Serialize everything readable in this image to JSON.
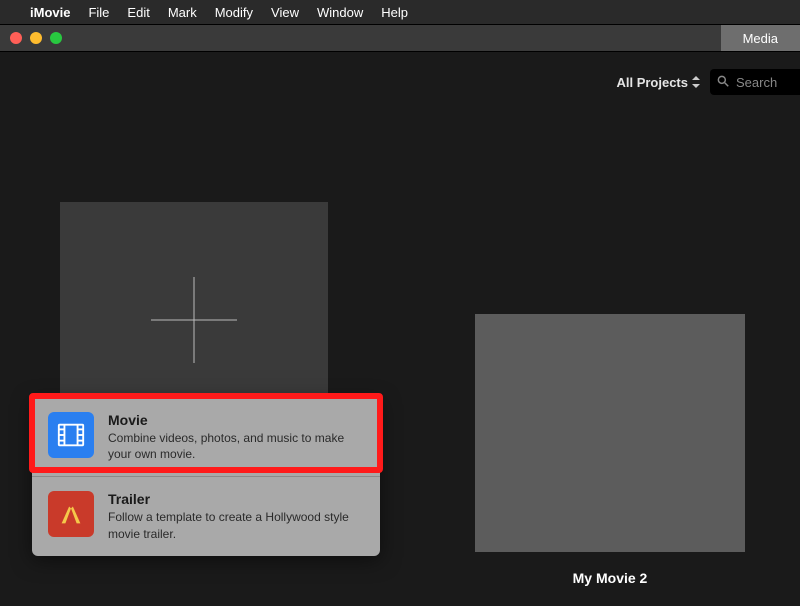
{
  "menubar": {
    "apple": "",
    "app": "iMovie",
    "items": [
      "File",
      "Edit",
      "Mark",
      "Modify",
      "View",
      "Window",
      "Help"
    ]
  },
  "window": {
    "tab": "Media"
  },
  "toolbar": {
    "dropdown_label": "All Projects",
    "search_placeholder": "Search"
  },
  "popover": {
    "items": [
      {
        "title": "Movie",
        "desc": "Combine videos, photos, and music to make your own movie."
      },
      {
        "title": "Trailer",
        "desc": "Follow a template to create a Hollywood style movie trailer."
      }
    ]
  },
  "projects": [
    {
      "name": "My Movie 2"
    }
  ]
}
